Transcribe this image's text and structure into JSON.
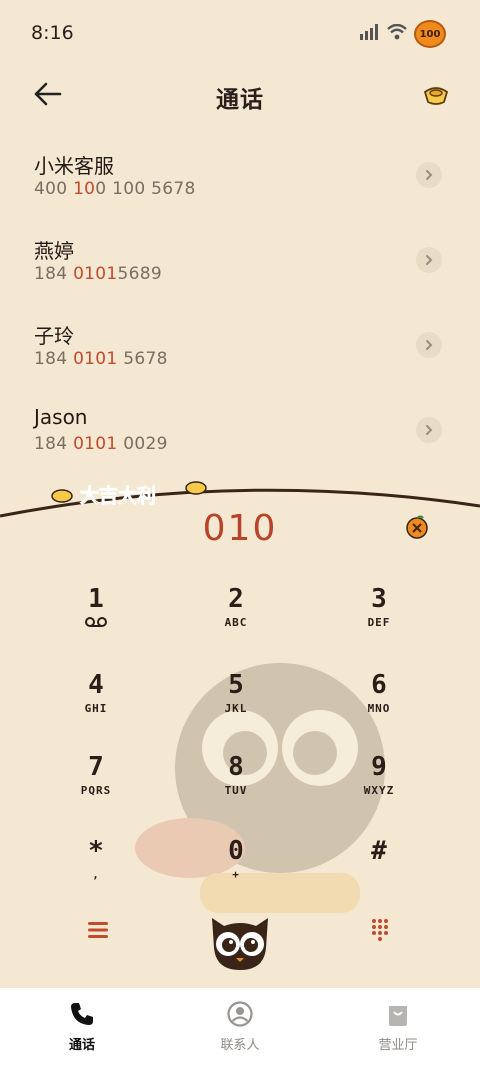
{
  "status_bar": {
    "time": "8:16",
    "battery": "100"
  },
  "header": {
    "title": "通话",
    "back_icon": "arrow-left-icon",
    "action_icon": "gold-ingot-icon"
  },
  "calls": [
    {
      "name": "小米客服",
      "number_parts": [
        "400 ",
        "10",
        "0 100 5678"
      ]
    },
    {
      "name": "燕婷",
      "number_parts": [
        "184 ",
        "0101",
        "5689"
      ]
    },
    {
      "name": "子玲",
      "number_parts": [
        "184 ",
        "0101",
        " 5678"
      ]
    },
    {
      "name": "Jason",
      "number_parts": [
        "184 ",
        "0101",
        " 0029"
      ]
    }
  ],
  "banner_text": "大吉大利",
  "dial": {
    "input": "010"
  },
  "keypad": [
    {
      "digit": "1",
      "sub": "voicemail-icon"
    },
    {
      "digit": "2",
      "sub": "ABC"
    },
    {
      "digit": "3",
      "sub": "DEF"
    },
    {
      "digit": "4",
      "sub": "GHI"
    },
    {
      "digit": "5",
      "sub": "JKL"
    },
    {
      "digit": "6",
      "sub": "MNO"
    },
    {
      "digit": "7",
      "sub": "PQRS"
    },
    {
      "digit": "8",
      "sub": "TUV"
    },
    {
      "digit": "9",
      "sub": "WXYZ"
    },
    {
      "digit": "*",
      "sub": ","
    },
    {
      "digit": "0",
      "sub": "+"
    },
    {
      "digit": "#",
      "sub": ""
    }
  ],
  "bottom_nav": [
    {
      "label": "通话",
      "icon": "phone-icon",
      "active": true
    },
    {
      "label": "联系人",
      "icon": "contact-icon",
      "active": false
    },
    {
      "label": "营业厅",
      "icon": "bag-icon",
      "active": false
    }
  ],
  "colors": {
    "accent": "#c24a2d",
    "background": "#f4e8d2"
  }
}
